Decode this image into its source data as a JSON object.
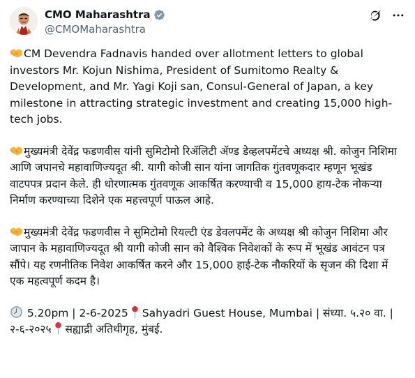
{
  "author": {
    "display_name": "CMO Maharashtra",
    "handle": "@CMOMaharashtra",
    "verified_icon": "gray-verified-badge-icon",
    "avatar_icon": "avatar"
  },
  "actions": {
    "grok_icon": "grok-icon",
    "more_icon": "more-options-icon"
  },
  "emoji": {
    "handshake": "handshake-icon",
    "clock": "clock-icon",
    "pin": "round-pushpin-icon"
  },
  "paragraphs": {
    "english": "CM Devendra Fadnavis handed over allotment letters to global investors Mr. Kojun Nishima, President of Sumitomo Realty & Development, and Mr. Yagi Koji san, Consul-General of Japan, a key milestone in attracting strategic investment and creating 15,000 high-tech jobs.",
    "marathi": "मुख्यमंत्री देवेंद्र फडणवीस यांनी सुमिटोमो रिॲलिटी ॲण्ड डेव्हलपमेंटचे अध्यक्ष श्री. कोजुन निशिमा आणि जपानचे महावाणिज्यदूत श्री. यागी कोजी सान यांना जागतिक गुंतवणूकदार म्हणून भूखंड वाटपपत्र प्रदान केले. ही धोरणात्मक गुंतवणूक आकर्षित करण्याची व 15,000 हाय-टेक नोकऱ्या निर्माण करण्याच्या दिशेने एक महत्त्वपूर्ण पाऊल आहे.",
    "hindi": "मुख्यमंत्री देवेंद्र फडणवीस ने सुमिटोमो रियल्टी एंड डेवलपमेंट के अध्यक्ष श्री कोजुन निशिमा और जापान के महावाणिज्यदूत श्री यागी कोजी सान को वैश्विक निवेशकों के रूप में भूखंड आवंटन पत्र सौंपे। यह रणनीतिक निवेश आकर्षित करने और 15,000 हाई-टेक नौकरियों के सृजन की दिशा में एक महत्वपूर्ण कदम है।",
    "time_part1": " 5.20pm | 2-6-2025",
    "location_en": "Sahyadri Guest House, Mumbai | संध्या. ५.२० वा. | २-६-२०२५",
    "location_mr": "सह्याद्री अतिथीगृह, मुंबई."
  }
}
